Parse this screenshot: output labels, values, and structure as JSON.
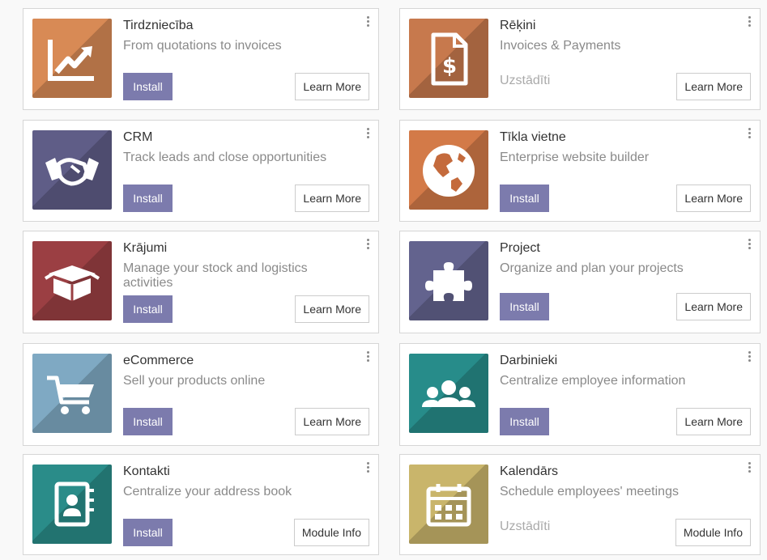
{
  "learn_more": "Learn More",
  "module_info": "Module Info",
  "install": "Install",
  "installed": "Uzstādīti",
  "apps": [
    {
      "name": "Tirdzniecība",
      "desc": "From quotations to invoices",
      "color": "#d88a55",
      "icon": "trend-chart-icon",
      "status": "install"
    },
    {
      "name": "Rēķini",
      "desc": "Invoices & Payments",
      "color": "#c7794d",
      "icon": "invoice-dollar-icon",
      "status": "installed"
    },
    {
      "name": "CRM",
      "desc": "Track leads and close opportunities",
      "color": "#5f5d87",
      "icon": "handshake-icon",
      "status": "install"
    },
    {
      "name": "Tīkla vietne",
      "desc": "Enterprise website builder",
      "color": "#d37a48",
      "icon": "globe-icon",
      "status": "install"
    },
    {
      "name": "Krājumi",
      "desc": "Manage your stock and logistics activities",
      "color": "#9b3f43",
      "icon": "box-icon",
      "status": "install"
    },
    {
      "name": "Project",
      "desc": "Organize and plan your projects",
      "color": "#63638e",
      "icon": "puzzle-icon",
      "status": "install"
    },
    {
      "name": "eCommerce",
      "desc": "Sell your products online",
      "color": "#7fa9c3",
      "icon": "cart-icon",
      "status": "install"
    },
    {
      "name": "Darbinieki",
      "desc": "Centralize employee information",
      "color": "#278c8a",
      "icon": "users-icon",
      "status": "install"
    },
    {
      "name": "Kontakti",
      "desc": "Centralize your address book",
      "color": "#2a8c89",
      "icon": "address-book-icon",
      "status": "install"
    },
    {
      "name": "Kalendārs",
      "desc": "Schedule employees' meetings",
      "color": "#c9b56b",
      "icon": "calendar-icon",
      "status": "installed"
    }
  ]
}
